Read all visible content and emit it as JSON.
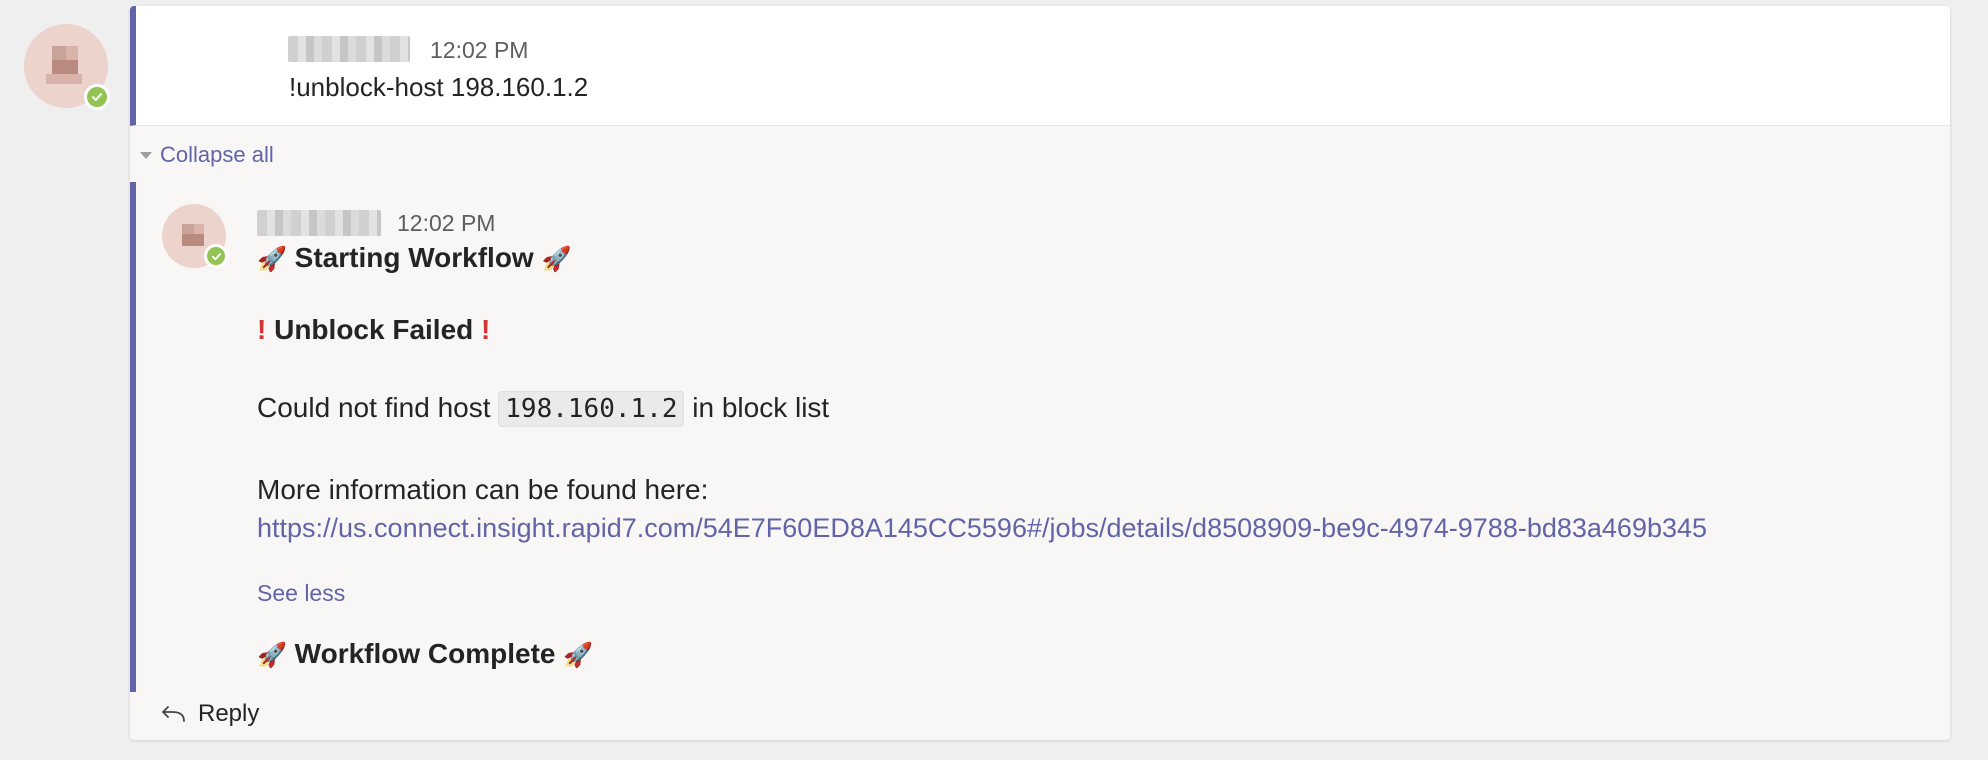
{
  "root_message": {
    "time": "12:02 PM",
    "text": "!unblock-host 198.160.1.2"
  },
  "thread": {
    "collapse_label": "Collapse all",
    "reply_label": "Reply"
  },
  "reply_message": {
    "time": "12:02 PM",
    "starting_text": "Starting Workflow",
    "failed_text": "Unblock Failed",
    "failed_mark": "!",
    "host_prefix": "Could not find host",
    "host_value": "198.160.1.2",
    "host_suffix": "in block list",
    "more_info_text": "More information can be found here:",
    "link_url": "https://us.connect.insight.rapid7.com/54E7F60ED8A145CC5596#/jobs/details/d8508909-be9c-4974-9788-bd83a469b345",
    "see_less_label": "See less",
    "complete_text": "Workflow Complete",
    "rocket_emoji": "🚀"
  },
  "icons": {
    "presence": "check-icon",
    "collapse": "triangle-down-icon",
    "reply": "reply-arrow-icon",
    "rocket": "rocket-icon"
  },
  "colors": {
    "accent": "#6264a7",
    "presence": "#92c353",
    "error": "#d13438"
  }
}
